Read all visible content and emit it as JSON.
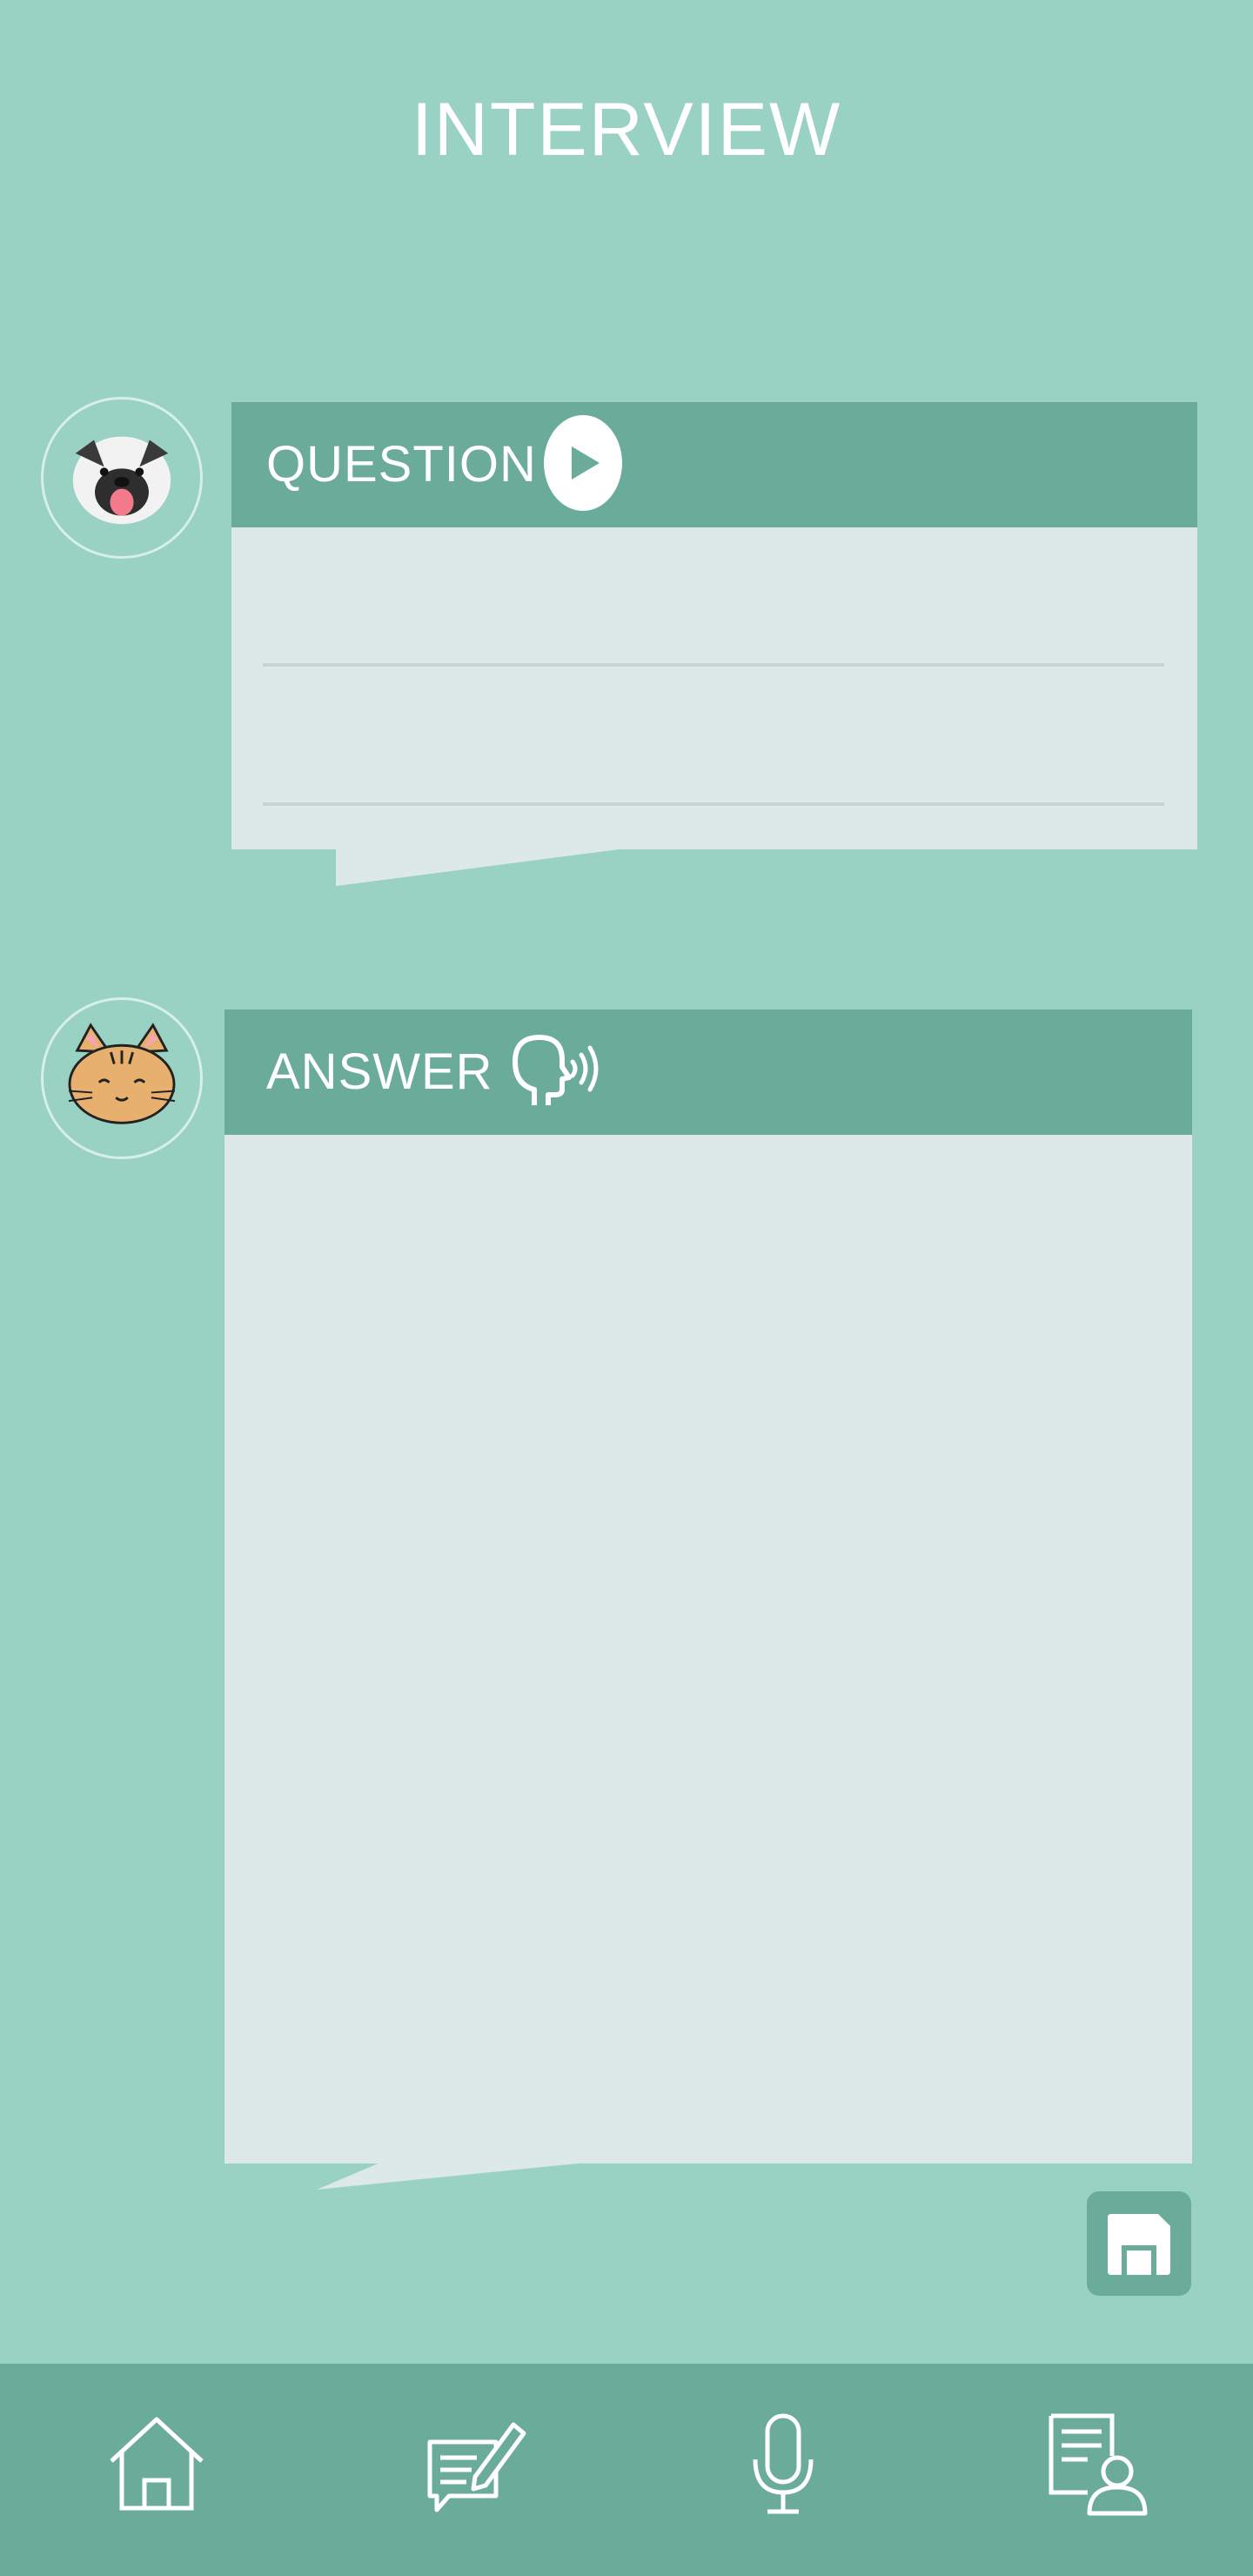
{
  "page": {
    "title": "INTERVIEW"
  },
  "question": {
    "label": "QUESTION",
    "play_icon": "play-icon",
    "text_lines": [
      "",
      ""
    ]
  },
  "answer": {
    "label": "ANSWER",
    "voice_icon": "speaking-head-icon",
    "text": ""
  },
  "avatars": {
    "interviewer": "dog-avatar",
    "interviewee": "cat-avatar"
  },
  "save": {
    "icon": "save-icon"
  },
  "bottom_nav": {
    "items": [
      {
        "name": "home",
        "icon": "home-icon"
      },
      {
        "name": "write",
        "icon": "edit-message-icon"
      },
      {
        "name": "record",
        "icon": "microphone-icon"
      },
      {
        "name": "profile",
        "icon": "user-document-icon"
      }
    ]
  },
  "colors": {
    "background": "#99d2c2",
    "header": "#6aab99",
    "bubble_body": "#dde9e6",
    "text": "#ffffff"
  }
}
